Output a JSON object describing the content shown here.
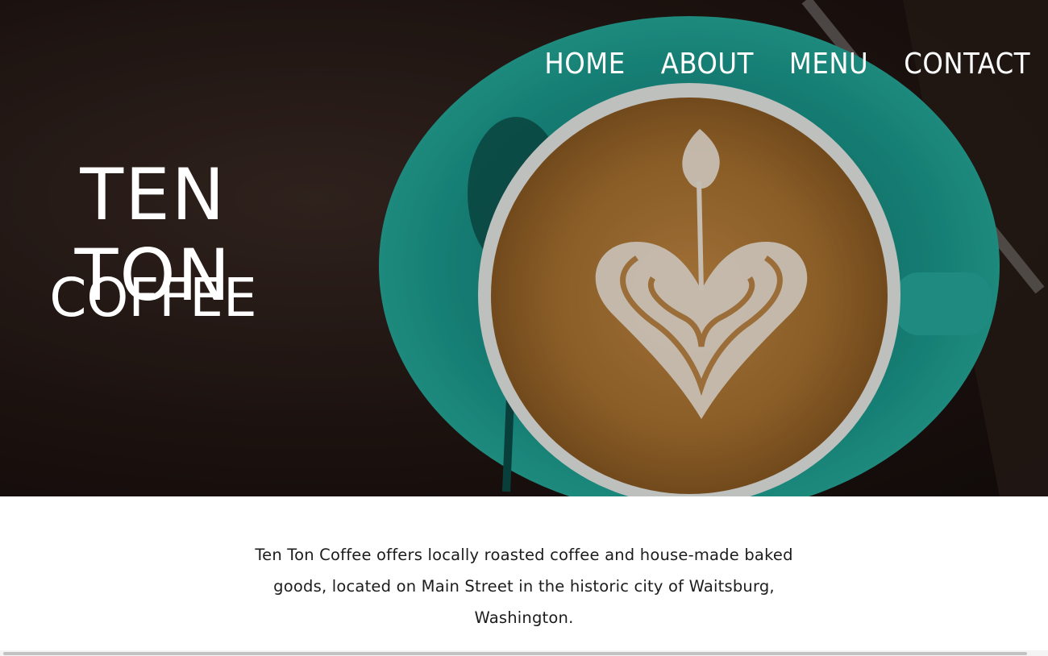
{
  "nav": {
    "items": [
      "HOME",
      "ABOUT",
      "MENU",
      "CONTACT"
    ]
  },
  "hero": {
    "title": "TEN TON",
    "subtitle": "COFFEE",
    "image": "coffee-cup-latte-art"
  },
  "intro": {
    "text": "Ten Ton Coffee offers locally roasted coffee and house-made baked goods, located on Main Street in the historic city of Waitsburg, Washington."
  },
  "colors": {
    "hero_dark": "#221613",
    "cup_teal": "#1b9a8e",
    "crema": "#a8712f",
    "text": "#1c1c1c"
  }
}
